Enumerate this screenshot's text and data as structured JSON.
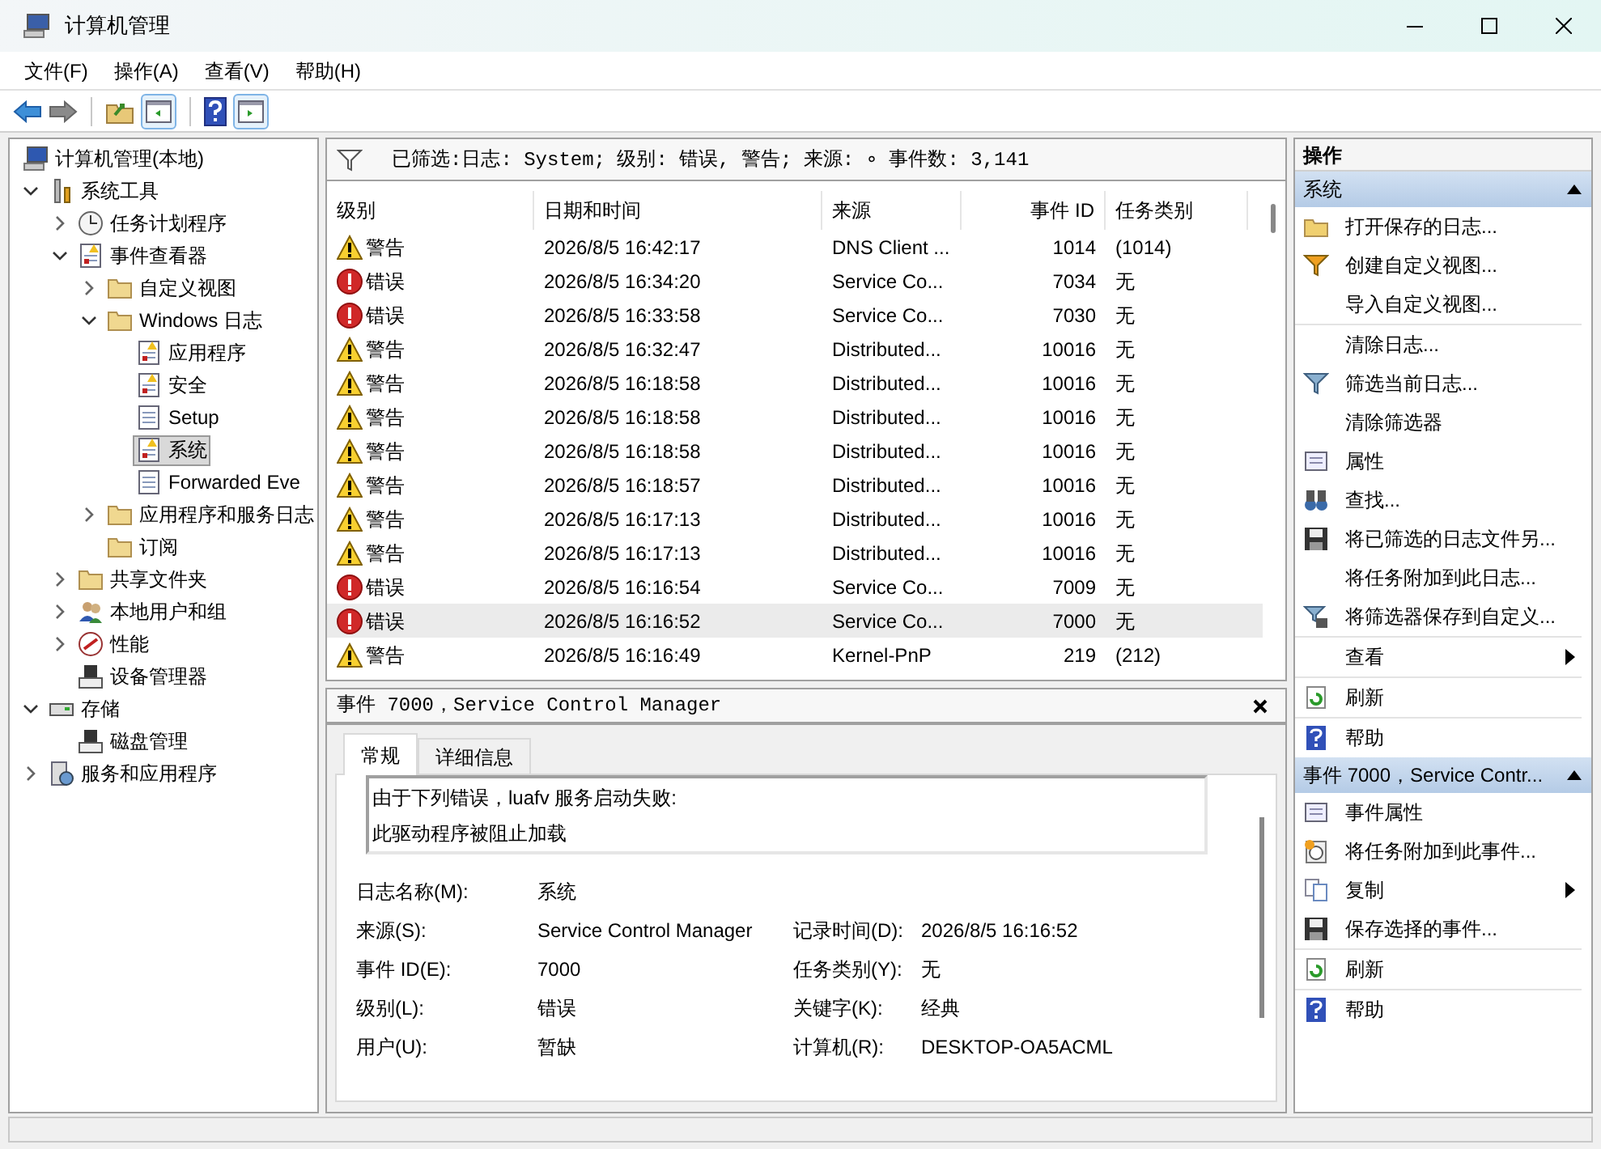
{
  "window": {
    "title": "计算机管理"
  },
  "menu": [
    "文件(F)",
    "操作(A)",
    "查看(V)",
    "帮助(H)"
  ],
  "tree": [
    {
      "label": "计算机管理(本地)",
      "selected": false,
      "children": [
        {
          "label": "系统工具",
          "selected": false,
          "expanded": true,
          "children": [
            {
              "label": "任务计划程序",
              "selected": false,
              "expanded": false
            },
            {
              "label": "事件查看器",
              "selected": false,
              "expanded": true,
              "children": [
                {
                  "label": "自定义视图",
                  "selected": false,
                  "expanded": false
                },
                {
                  "label": "Windows 日志",
                  "selected": false,
                  "expanded": true,
                  "children": [
                    {
                      "label": "应用程序",
                      "selected": false
                    },
                    {
                      "label": "安全",
                      "selected": false
                    },
                    {
                      "label": "Setup",
                      "selected": false
                    },
                    {
                      "label": "系统",
                      "selected": true
                    },
                    {
                      "label": "Forwarded Eve",
                      "selected": false
                    }
                  ]
                },
                {
                  "label": "应用程序和服务日志",
                  "selected": false,
                  "expanded": false
                },
                {
                  "label": "订阅",
                  "selected": false
                }
              ]
            },
            {
              "label": "共享文件夹",
              "selected": false,
              "expanded": false
            },
            {
              "label": "本地用户和组",
              "selected": false,
              "expanded": false
            },
            {
              "label": "性能",
              "selected": false,
              "expanded": false
            },
            {
              "label": "设备管理器",
              "selected": false
            }
          ]
        },
        {
          "label": "存储",
          "selected": false,
          "expanded": true,
          "children": [
            {
              "label": "磁盘管理",
              "selected": false
            }
          ]
        },
        {
          "label": "服务和应用程序",
          "selected": false,
          "expanded": false
        }
      ]
    }
  ],
  "filter_text": "已筛选:日志: System; 级别: 错误, 警告; 来源: ∘ 事件数: 3,141",
  "table": {
    "columns": [
      "级别",
      "日期和时间",
      "来源",
      "事件 ID",
      "任务类别"
    ],
    "rows": [
      {
        "kind": "warning",
        "level": "警告",
        "date": "2026/8/5 16:42:17",
        "source": "DNS Client ...",
        "id": "1014",
        "category": "(1014)",
        "selected": false
      },
      {
        "kind": "error",
        "level": "错误",
        "date": "2026/8/5 16:34:20",
        "source": "Service Co...",
        "id": "7034",
        "category": "无",
        "selected": false
      },
      {
        "kind": "error",
        "level": "错误",
        "date": "2026/8/5 16:33:58",
        "source": "Service Co...",
        "id": "7030",
        "category": "无",
        "selected": false
      },
      {
        "kind": "warning",
        "level": "警告",
        "date": "2026/8/5 16:32:47",
        "source": "Distributed...",
        "id": "10016",
        "category": "无",
        "selected": false
      },
      {
        "kind": "warning",
        "level": "警告",
        "date": "2026/8/5 16:18:58",
        "source": "Distributed...",
        "id": "10016",
        "category": "无",
        "selected": false
      },
      {
        "kind": "warning",
        "level": "警告",
        "date": "2026/8/5 16:18:58",
        "source": "Distributed...",
        "id": "10016",
        "category": "无",
        "selected": false
      },
      {
        "kind": "warning",
        "level": "警告",
        "date": "2026/8/5 16:18:58",
        "source": "Distributed...",
        "id": "10016",
        "category": "无",
        "selected": false
      },
      {
        "kind": "warning",
        "level": "警告",
        "date": "2026/8/5 16:18:57",
        "source": "Distributed...",
        "id": "10016",
        "category": "无",
        "selected": false
      },
      {
        "kind": "warning",
        "level": "警告",
        "date": "2026/8/5 16:17:13",
        "source": "Distributed...",
        "id": "10016",
        "category": "无",
        "selected": false
      },
      {
        "kind": "warning",
        "level": "警告",
        "date": "2026/8/5 16:17:13",
        "source": "Distributed...",
        "id": "10016",
        "category": "无",
        "selected": false
      },
      {
        "kind": "error",
        "level": "错误",
        "date": "2026/8/5 16:16:54",
        "source": "Service Co...",
        "id": "7009",
        "category": "无",
        "selected": false
      },
      {
        "kind": "error",
        "level": "错误",
        "date": "2026/8/5 16:16:52",
        "source": "Service Co...",
        "id": "7000",
        "category": "无",
        "selected": true
      },
      {
        "kind": "warning",
        "level": "警告",
        "date": "2026/8/5 16:16:49",
        "source": "Kernel-PnP",
        "id": "219",
        "category": "(212)",
        "selected": false
      }
    ]
  },
  "detail": {
    "title": "事件 7000，Service Control Manager",
    "tabs": [
      {
        "label": "常规",
        "selected": true
      },
      {
        "label": "详细信息",
        "selected": false
      }
    ],
    "message": [
      "由于下列错误，luafv 服务启动失败:",
      "此驱动程序被阻止加载"
    ],
    "rows": [
      [
        {
          "label": "日志名称(M):",
          "value": "系统"
        }
      ],
      [
        {
          "label": "来源(S):",
          "value": "Service Control Manager"
        },
        {
          "label": "记录时间(D):",
          "value": "2026/8/5 16:16:52"
        }
      ],
      [
        {
          "label": "事件 ID(E):",
          "value": "7000"
        },
        {
          "label": "任务类别(Y):",
          "value": "无"
        }
      ],
      [
        {
          "label": "级别(L):",
          "value": "错误"
        },
        {
          "label": "关键字(K):",
          "value": "经典"
        }
      ],
      [
        {
          "label": "用户(U):",
          "value": "暂缺"
        },
        {
          "label": "计算机(R):",
          "value": "DESKTOP-OA5ACML"
        }
      ]
    ]
  },
  "actions": {
    "title": "操作",
    "sections": [
      {
        "title": "系统",
        "expanded": true,
        "groups": [
          [
            {
              "label": "打开保存的日志...",
              "submenu": false
            },
            {
              "label": "创建自定义视图...",
              "submenu": false
            },
            {
              "label": "导入自定义视图...",
              "submenu": false
            }
          ],
          [
            {
              "label": "清除日志...",
              "submenu": false
            },
            {
              "label": "筛选当前日志...",
              "submenu": false
            },
            {
              "label": "清除筛选器",
              "submenu": false
            },
            {
              "label": "属性",
              "submenu": false
            },
            {
              "label": "查找...",
              "submenu": false
            },
            {
              "label": "将已筛选的日志文件另...",
              "submenu": false
            },
            {
              "label": "将任务附加到此日志...",
              "submenu": false
            },
            {
              "label": "将筛选器保存到自定义...",
              "submenu": false
            }
          ],
          [
            {
              "label": "查看",
              "submenu": true
            }
          ],
          [
            {
              "label": "刷新",
              "submenu": false
            }
          ],
          [
            {
              "label": "帮助",
              "submenu": false
            }
          ]
        ]
      },
      {
        "title": "事件 7000，Service Contr...",
        "expanded": true,
        "groups": [
          [
            {
              "label": "事件属性",
              "submenu": false
            },
            {
              "label": "将任务附加到此事件...",
              "submenu": false
            },
            {
              "label": "复制",
              "submenu": true
            },
            {
              "label": "保存选择的事件..."
            }
          ],
          [
            {
              "label": "刷新",
              "submenu": false
            }
          ],
          [
            {
              "label": "帮助",
              "submenu": false
            }
          ]
        ]
      }
    ]
  }
}
